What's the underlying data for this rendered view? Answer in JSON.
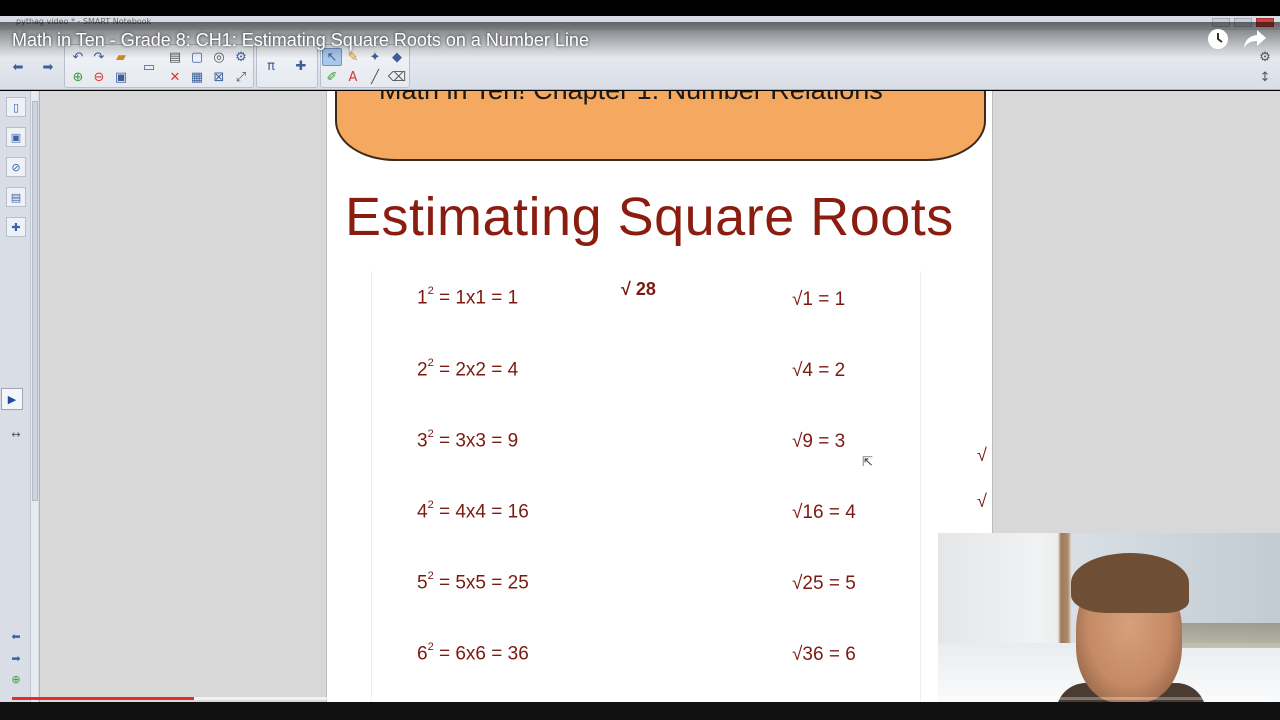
{
  "window": {
    "title": "pythag video * - SMART Notebook"
  },
  "video": {
    "title": "Math in Ten - Grade 8: CH1: Estimating Square Roots on a Number Line",
    "played_fraction": 0.145,
    "loaded_fraction": 0.32
  },
  "slide": {
    "banner": "Math in Ten! Chapter 1: Number Relations",
    "title": "Estimating Square Roots",
    "annotation": "√ 28",
    "squares": [
      {
        "base": "1",
        "exp": "2",
        "rest": " = 1x1 = 1"
      },
      {
        "base": "2",
        "exp": "2",
        "rest": " = 2x2 = 4"
      },
      {
        "base": "3",
        "exp": "2",
        "rest": " = 3x3 = 9"
      },
      {
        "base": "4",
        "exp": "2",
        "rest": " = 4x4 = 16"
      },
      {
        "base": "5",
        "exp": "2",
        "rest": " = 5x5 = 25"
      },
      {
        "base": "6",
        "exp": "2",
        "rest": " = 6x6 = 36"
      }
    ],
    "roots": [
      "√1 = 1",
      "√4 = 2",
      "√9 = 3",
      "√16 = 4",
      "√25 = 5",
      "√36 = 6"
    ],
    "stray_marks": [
      "√",
      "√"
    ]
  },
  "icons": {
    "back": "arrow-left-icon",
    "forward": "arrow-right-icon",
    "clock": "watch-later-icon",
    "share": "share-icon"
  },
  "colors": {
    "banner": "#f5a860",
    "title": "#8b1c10",
    "text": "#7a1a10",
    "progress": "#e52d27"
  }
}
